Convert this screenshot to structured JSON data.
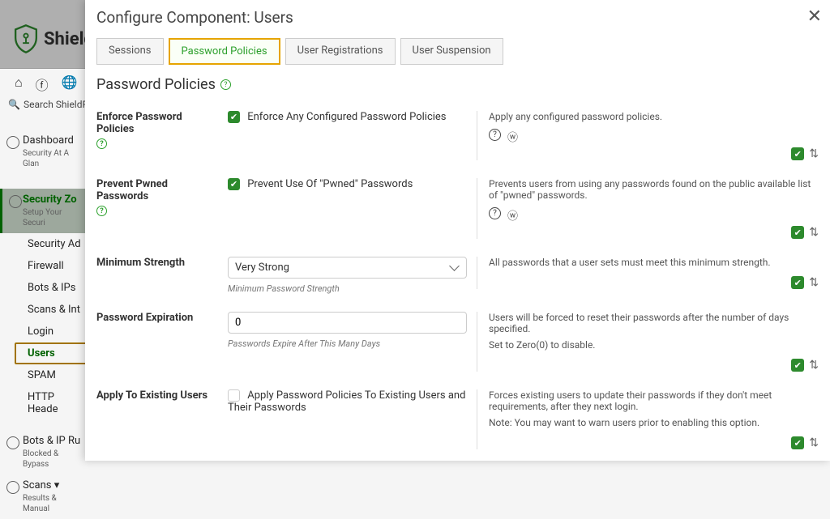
{
  "app": {
    "name": "ShieldPRO",
    "search_placeholder": "Search ShieldPRO"
  },
  "sidebar": {
    "dashboard": {
      "label": "Dashboard",
      "sub": "Security At A Glan"
    },
    "zones": {
      "label": "Security Zo",
      "sub": "Setup Your Securi"
    },
    "items": [
      {
        "label": "Security Ad"
      },
      {
        "label": "Firewall"
      },
      {
        "label": "Bots & IPs"
      },
      {
        "label": "Scans & Int"
      },
      {
        "label": "Login"
      },
      {
        "label": "Users"
      },
      {
        "label": "SPAM"
      },
      {
        "label": "HTTP Heade"
      }
    ],
    "bots_rules": {
      "label": "Bots & IP Ru",
      "sub": "Blocked & Bypass"
    },
    "scans": {
      "label": "Scans ▾",
      "sub": "Results & Manual"
    }
  },
  "modal": {
    "title": "Configure Component: Users",
    "tabs": [
      {
        "label": "Sessions"
      },
      {
        "label": "Password Policies"
      },
      {
        "label": "User Registrations"
      },
      {
        "label": "User Suspension"
      }
    ],
    "section_title": "Password Policies",
    "fields": {
      "enforce": {
        "label": "Enforce Password Policies",
        "control_label": "Enforce Any Configured Password Policies",
        "desc": "Apply any configured password policies."
      },
      "pwned": {
        "label": "Prevent Pwned Passwords",
        "control_label": "Prevent Use Of \"Pwned\" Passwords",
        "desc": "Prevents users from using any passwords found on the public available list of \"pwned\" passwords."
      },
      "strength": {
        "label": "Minimum Strength",
        "value": "Very Strong",
        "hint": "Minimum Password Strength",
        "desc": "All passwords that a user sets must meet this minimum strength."
      },
      "expiration": {
        "label": "Password Expiration",
        "value": "0",
        "hint": "Passwords Expire After This Many Days",
        "desc1": "Users will be forced to reset their passwords after the number of days specified.",
        "desc2": "Set to Zero(0) to disable."
      },
      "apply_existing": {
        "label": "Apply To Existing Users",
        "control_label": "Apply Password Policies To Existing Users and Their Passwords",
        "desc1": "Forces existing users to update their passwords if they don't meet requirements, after they next login.",
        "desc2": "Note: You may want to warn users prior to enabling this option."
      }
    }
  }
}
